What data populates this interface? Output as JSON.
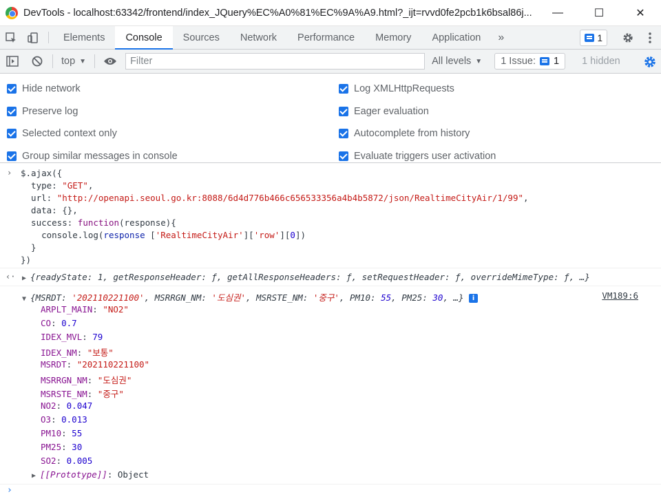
{
  "window": {
    "title": "DevTools - localhost:63342/frontend/index_JQuery%EC%A0%81%EC%9A%A9.html?_ijt=rvvd0fe2pcb1k6bsal86j...",
    "minimize": "—",
    "maximize": "☐",
    "close": "✕"
  },
  "tabs": [
    "Elements",
    "Console",
    "Sources",
    "Network",
    "Performance",
    "Memory",
    "Application"
  ],
  "active_tab": "Console",
  "more_tabs": "»",
  "message_count": "1",
  "toolbar": {
    "context": "top",
    "filter_placeholder": "Filter",
    "levels": "All levels",
    "issues_label": "1 Issue:",
    "issues_count": "1",
    "hidden": "1 hidden"
  },
  "settings": {
    "left": [
      "Hide network",
      "Preserve log",
      "Selected context only",
      "Group similar messages in console"
    ],
    "right": [
      "Log XMLHttpRequests",
      "Eager evaluation",
      "Autocomplete from history",
      "Evaluate triggers user activation"
    ]
  },
  "input_code": {
    "l1": "$.ajax({",
    "l2_key": "  type: ",
    "l2_val": "\"GET\"",
    "l2_end": ",",
    "l3_key": "  url: ",
    "l3_val": "\"http://openapi.seoul.go.kr:8088/6d4d776b466c656533356a4b4b5872/json/RealtimeCityAir/1/99\"",
    "l3_end": ",",
    "l4": "  data: {},",
    "l5_key": "  success: ",
    "l5_fn": "function",
    "l5_arg": "(response){",
    "l6_a": "    console.log(",
    "l6_b": "response",
    "l6_c": " [",
    "l6_d": "'RealtimeCityAir'",
    "l6_e": "][",
    "l6_f": "'row'",
    "l6_g": "][",
    "l6_h": "0",
    "l6_i": "])",
    "l7": "  }",
    "l8": "})"
  },
  "result_line": {
    "text": "{readyState: 1, getResponseHeader: ƒ, getAllResponseHeaders: ƒ, setRequestHeader: ƒ, overrideMimeType: ƒ, …}"
  },
  "log_object": {
    "summary_open": "{",
    "k1": "MSRDT: ",
    "v1": "'202110221100'",
    "k2": ", MSRRGN_NM: ",
    "v2": "'도심권'",
    "k3": ", MSRSTE_NM: ",
    "v3": "'중구'",
    "k4": ", PM10: ",
    "v4": "55",
    "k5": ", PM25: ",
    "v5": "30",
    "summary_close": ", …}",
    "info": "i",
    "source": "VM189:6",
    "props": [
      {
        "key": "ARPLT_MAIN",
        "value": "\"NO2\"",
        "type": "string"
      },
      {
        "key": "CO",
        "value": "0.7",
        "type": "number"
      },
      {
        "key": "IDEX_MVL",
        "value": "79",
        "type": "number"
      },
      {
        "key": "IDEX_NM",
        "value": "\"보통\"",
        "type": "string"
      },
      {
        "key": "MSRDT",
        "value": "\"202110221100\"",
        "type": "string"
      },
      {
        "key": "MSRRGN_NM",
        "value": "\"도심권\"",
        "type": "string"
      },
      {
        "key": "MSRSTE_NM",
        "value": "\"중구\"",
        "type": "string"
      },
      {
        "key": "NO2",
        "value": "0.047",
        "type": "number"
      },
      {
        "key": "O3",
        "value": "0.013",
        "type": "number"
      },
      {
        "key": "PM10",
        "value": "55",
        "type": "number"
      },
      {
        "key": "PM25",
        "value": "30",
        "type": "number"
      },
      {
        "key": "SO2",
        "value": "0.005",
        "type": "number"
      }
    ],
    "prototype_key": "[[Prototype]]",
    "prototype_value": ": Object"
  },
  "colors": {
    "accent": "#1a73e8",
    "string": "#c41a16",
    "number": "#1c00cf",
    "key": "#881391"
  }
}
